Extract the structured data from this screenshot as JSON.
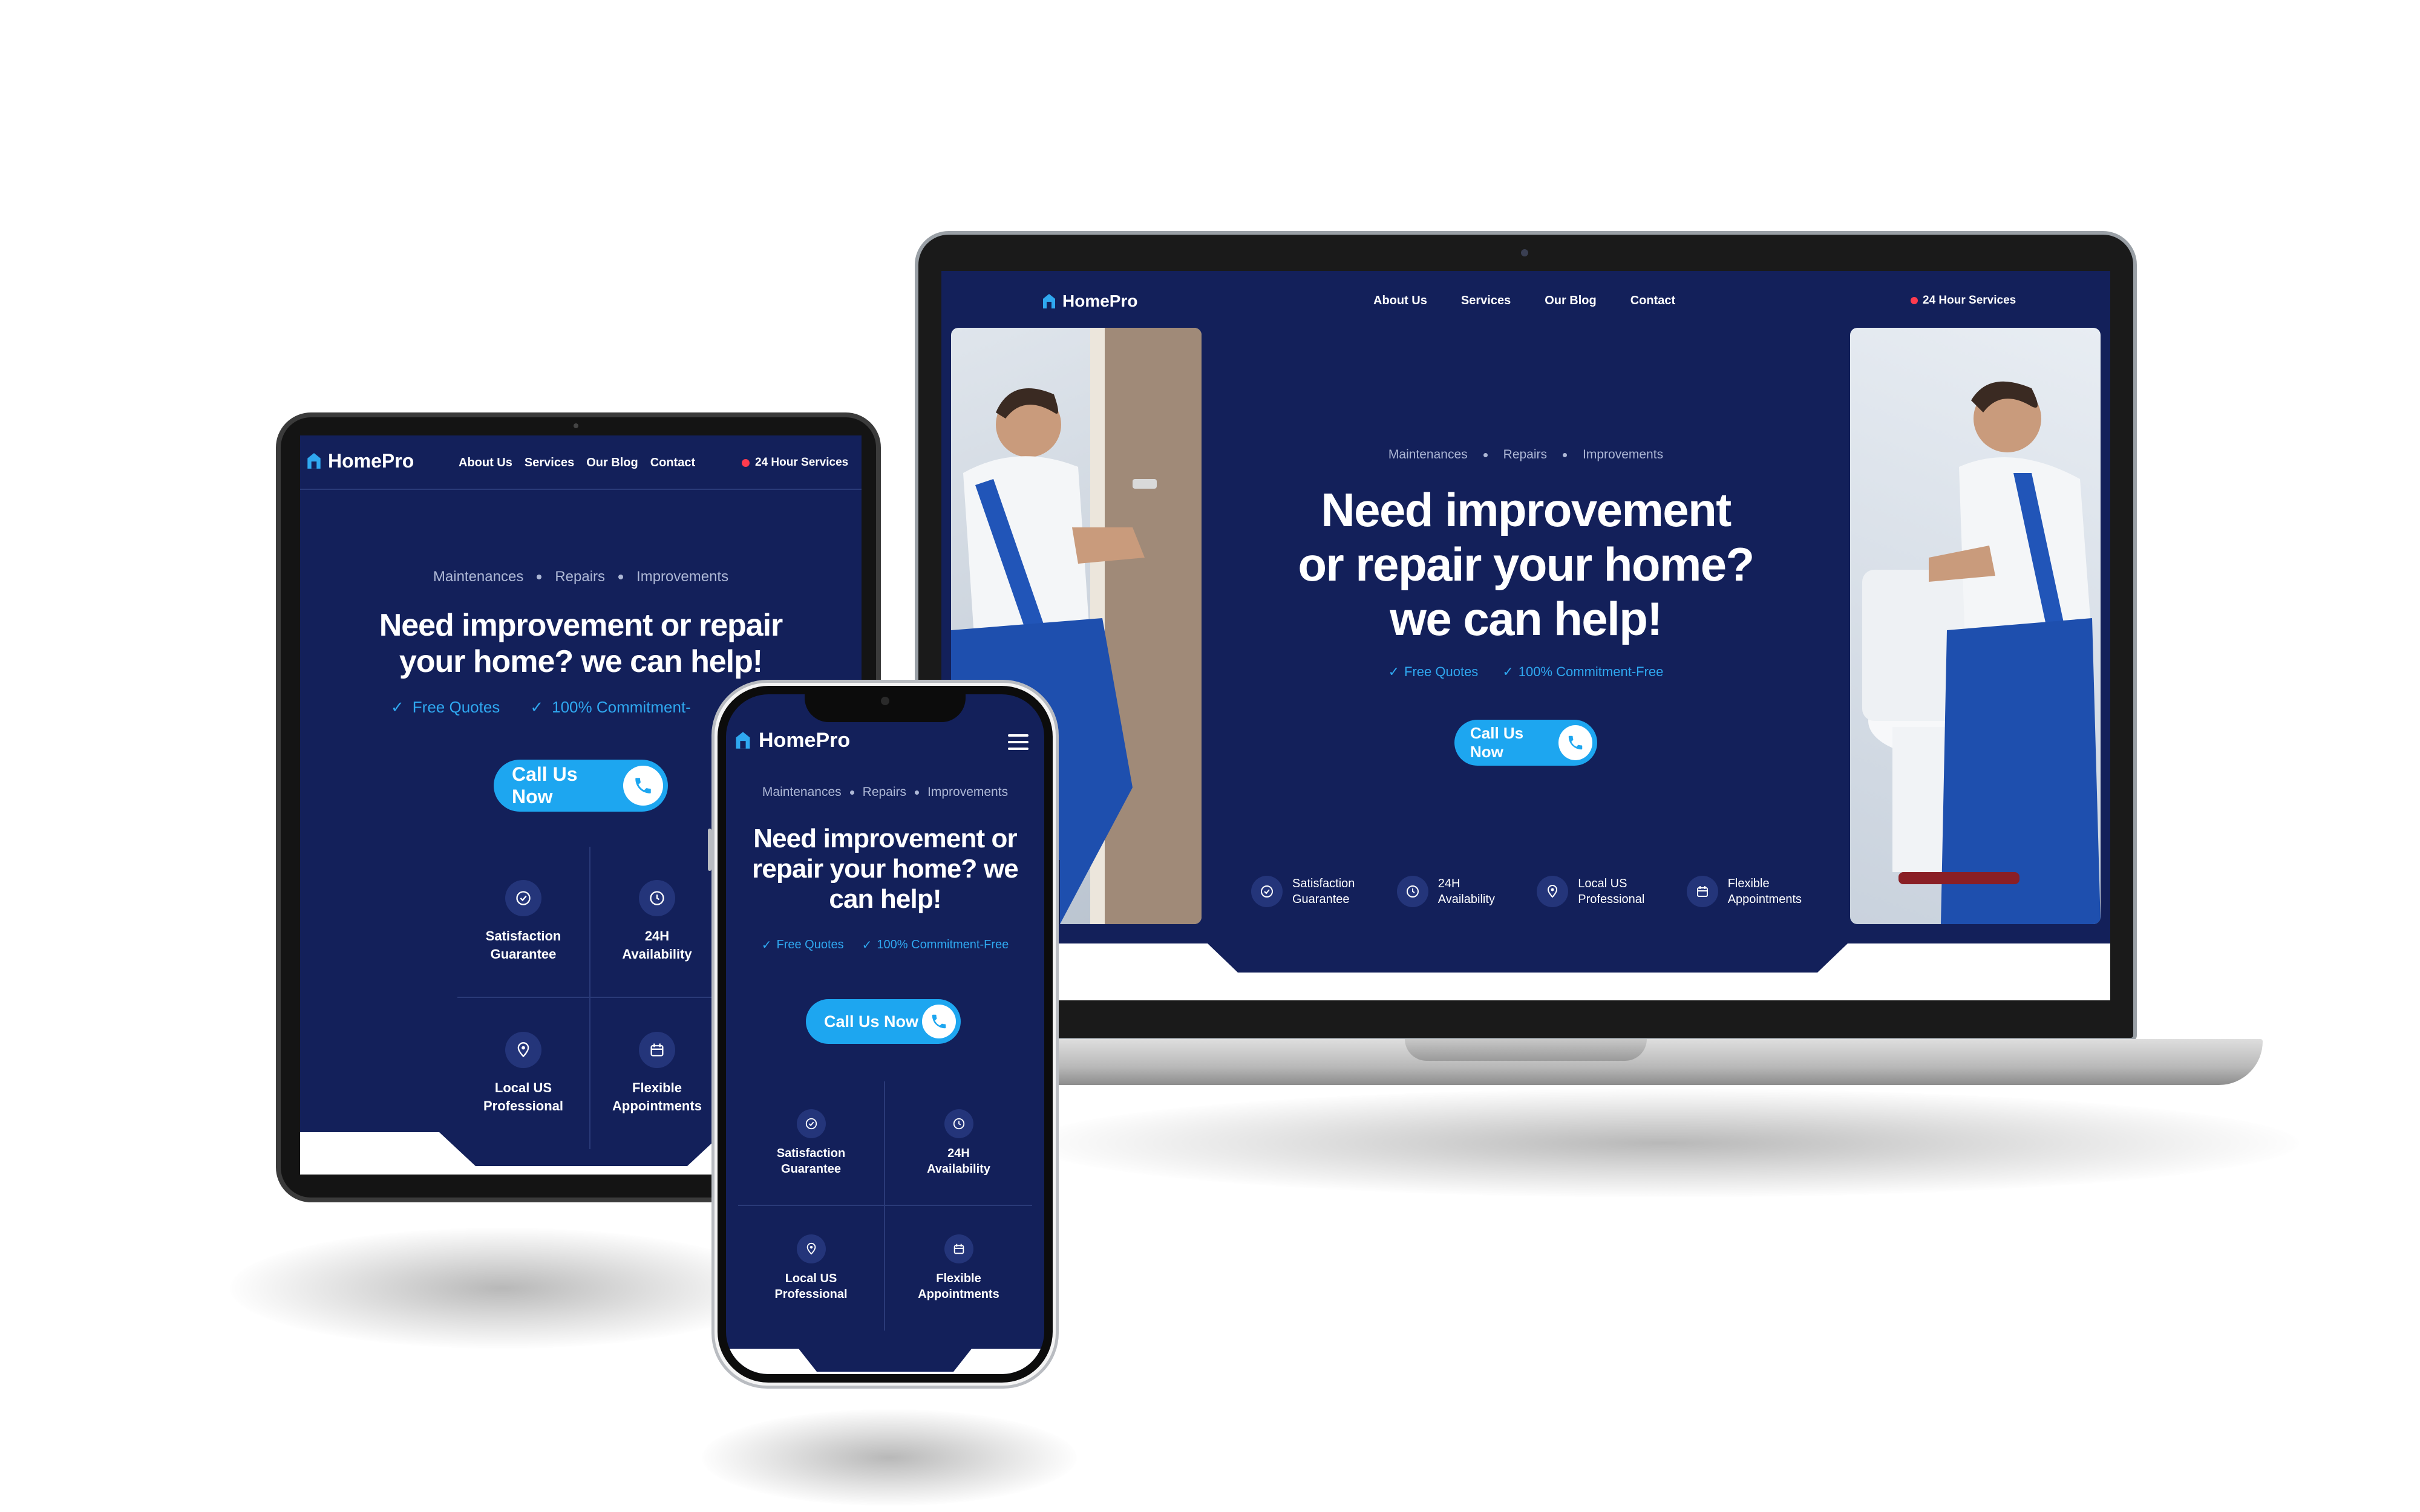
{
  "brand": {
    "name": "HomePro"
  },
  "nav": {
    "items": [
      "About Us",
      "Services",
      "Our Blog",
      "Contact"
    ]
  },
  "header": {
    "badge_label": "24 Hour Services"
  },
  "hero": {
    "crumbs": [
      "Maintenances",
      "Repairs",
      "Improvements"
    ],
    "headline_laptop_lines": [
      "Need improvement",
      "or repair your home?",
      "we can help!"
    ],
    "headline_tablet_lines": [
      "Need improvement or repair",
      "your home? we can help!"
    ],
    "headline_phone_lines": [
      "Need improvement or",
      "repair your home? we",
      "can help!"
    ],
    "checks": [
      "Free Quotes",
      "100% Commitment-Free"
    ],
    "tablet_checks": [
      "Free Quotes",
      "100% Commitment-"
    ],
    "cta_label": "Call Us Now"
  },
  "features": [
    {
      "line1": "Satisfaction",
      "line2": "Guarantee",
      "icon": "shield-check-icon"
    },
    {
      "line1": "24H",
      "line2": "Availability",
      "icon": "clock-icon"
    },
    {
      "line1": "Local US",
      "line2": "Professional",
      "icon": "location-pin-icon"
    },
    {
      "line1": "Flexible",
      "line2": "Appointments",
      "icon": "calendar-icon"
    }
  ],
  "colors": {
    "background": "#13205a",
    "accent": "#1da6f0",
    "check_text": "#2fa8f0",
    "badge_dot": "#ff3b4e"
  }
}
